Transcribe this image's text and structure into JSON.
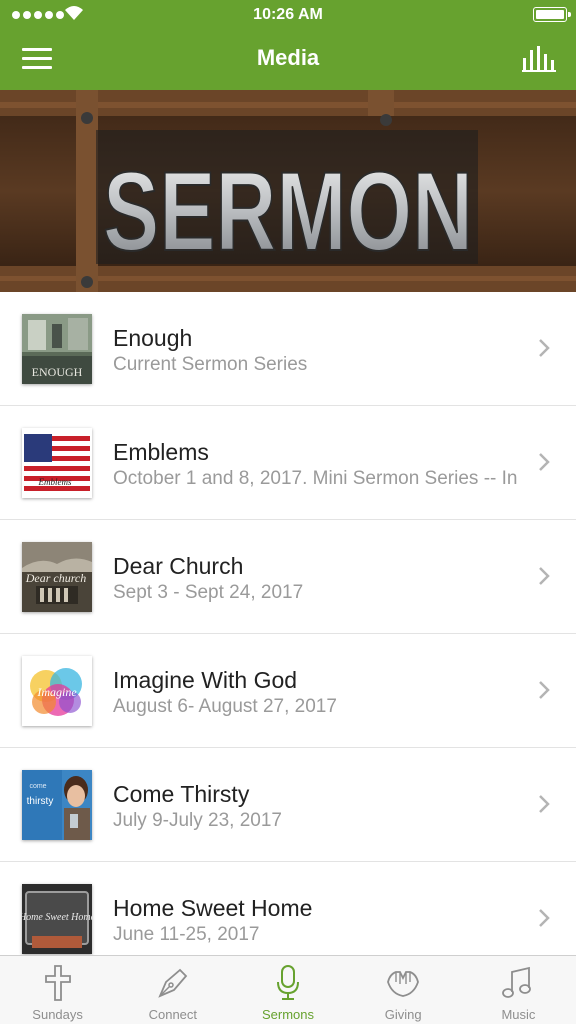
{
  "status_bar": {
    "time": "10:26 AM"
  },
  "header": {
    "title": "Media"
  },
  "hero": {
    "word": "SERMON"
  },
  "sermons": [
    {
      "title": "Enough",
      "subtitle": "Current Sermon Series",
      "thumb_text": "ENOUGH"
    },
    {
      "title": "Emblems",
      "subtitle": "October 1 and 8, 2017.  Mini Sermon Series -- In",
      "thumb_text": "Emblems"
    },
    {
      "title": "Dear Church",
      "subtitle": "Sept 3 - Sept 24, 2017",
      "thumb_text": "Dear church"
    },
    {
      "title": "Imagine With God",
      "subtitle": "August 6- August 27, 2017",
      "thumb_text": "Imagine"
    },
    {
      "title": "Come Thirsty",
      "subtitle": "July 9-July 23, 2017",
      "thumb_text_1": "come",
      "thumb_text_2": "thirsty"
    },
    {
      "title": "Home Sweet Home",
      "subtitle": "June 11-25, 2017",
      "thumb_text": "Home Sweet Home"
    }
  ],
  "tabs": [
    {
      "label": "Sundays",
      "icon": "cross-icon"
    },
    {
      "label": "Connect",
      "icon": "pen-nib-icon"
    },
    {
      "label": "Sermons",
      "icon": "microphone-icon",
      "active": true
    },
    {
      "label": "Giving",
      "icon": "praying-hands-icon"
    },
    {
      "label": "Music",
      "icon": "music-note-icon"
    }
  ],
  "colors": {
    "brand_green": "#67a22f",
    "title_text": "#222222",
    "subtitle_text": "#9a9a9a"
  }
}
